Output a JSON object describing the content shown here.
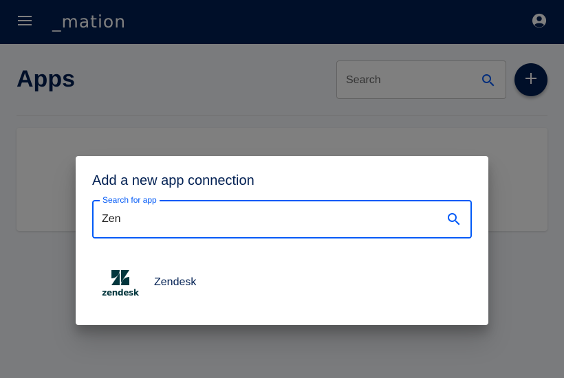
{
  "appbar": {
    "logo_text": "_mation",
    "menu_icon": "menu-icon",
    "account_icon": "account-circle-icon"
  },
  "page": {
    "title": "Apps",
    "search_placeholder": "Search",
    "search_icon": "search-icon",
    "add_icon": "plus-icon"
  },
  "dialog": {
    "title": "Add a new app connection",
    "search_label": "Search for app",
    "search_value": "Zen",
    "search_icon": "search-icon",
    "results": [
      {
        "label": "Zendesk",
        "logo_text": "zendesk",
        "icon": "zendesk-logo"
      }
    ]
  },
  "colors": {
    "primary": "#001f52",
    "accent": "#0059f7",
    "zendesk": "#03363d"
  }
}
